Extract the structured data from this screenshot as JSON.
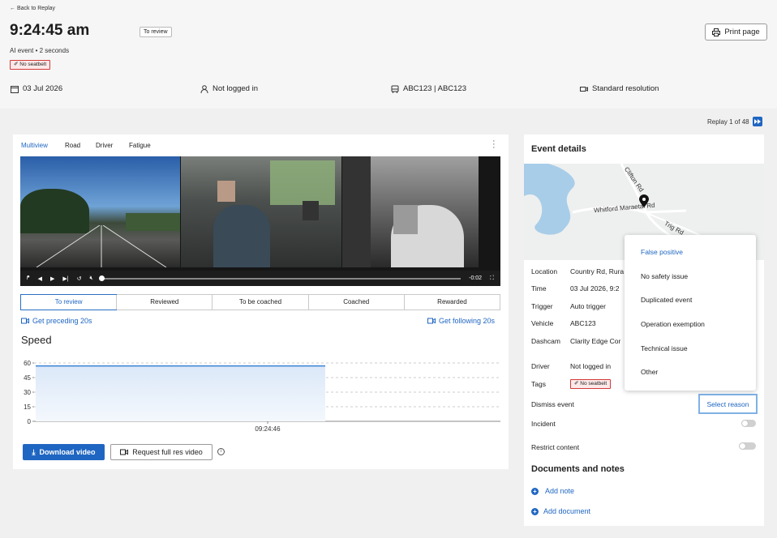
{
  "nav": {
    "back": "Back to Replay"
  },
  "event": {
    "time": "9:24:45 am",
    "status": "To review",
    "subtitle": "AI event • 2 seconds",
    "tag": "No seatbelt",
    "print": "Print page"
  },
  "info": {
    "date": "03 Jul 2026",
    "driver": "Not logged in",
    "vehicle": "ABC123 | ABC123",
    "resolution": "Standard resolution"
  },
  "replay": {
    "counter": "Replay 1 of 48"
  },
  "video": {
    "tabs": [
      "Multiview",
      "Road",
      "Driver",
      "Fatigue"
    ],
    "active_tab": "Multiview",
    "time_remaining": "-0:02",
    "progress": 0.0
  },
  "review_tabs": [
    "To review",
    "Reviewed",
    "To be coached",
    "Coached",
    "Rewarded"
  ],
  "links": {
    "preceding": "Get preceding 20s",
    "following": "Get following 20s"
  },
  "speed": {
    "title": "Speed",
    "buttons": {
      "download": "Download video",
      "request": "Request full res video"
    }
  },
  "chart_data": {
    "type": "area",
    "title": "Speed",
    "ylim": [
      0,
      60
    ],
    "yticks": [
      "60",
      "45",
      "30",
      "15",
      "0"
    ],
    "xticks": [
      "09:24:46"
    ],
    "series": [
      {
        "values": [
          57,
          57,
          57
        ]
      }
    ],
    "grid": true,
    "color": "#3b82d6"
  },
  "details": {
    "title": "Event details",
    "map_labels": {
      "road1": "Whitford Maraetai Rd",
      "road2": "Clifton Rd",
      "road3": "Trig Rd"
    },
    "rows": [
      {
        "label": "Location",
        "value": "Country Rd, Rura"
      },
      {
        "label": "Time",
        "value": "03 Jul 2026, 9:2"
      },
      {
        "label": "Trigger",
        "value": "Auto trigger"
      },
      {
        "label": "Vehicle",
        "value": "ABC123"
      },
      {
        "label": "Dashcam",
        "value": "Clarity Edge Cor"
      }
    ],
    "driver_label": "Driver",
    "driver_value": "Not logged in",
    "tags_label": "Tags",
    "tag": "No seatbelt",
    "dismiss_label": "Dismiss event",
    "dismiss_action": "Select reason",
    "incident_label": "Incident",
    "restrict_label": "Restrict content",
    "docs_title": "Documents and notes",
    "add_note": "Add note",
    "add_doc": "Add document"
  },
  "dismiss_menu": [
    "False positive",
    "No safety issue",
    "Duplicated event",
    "Operation exemption",
    "Technical issue",
    "Other"
  ],
  "colors": {
    "accent": "#1f66c2",
    "tag_border": "#d23a3a"
  }
}
